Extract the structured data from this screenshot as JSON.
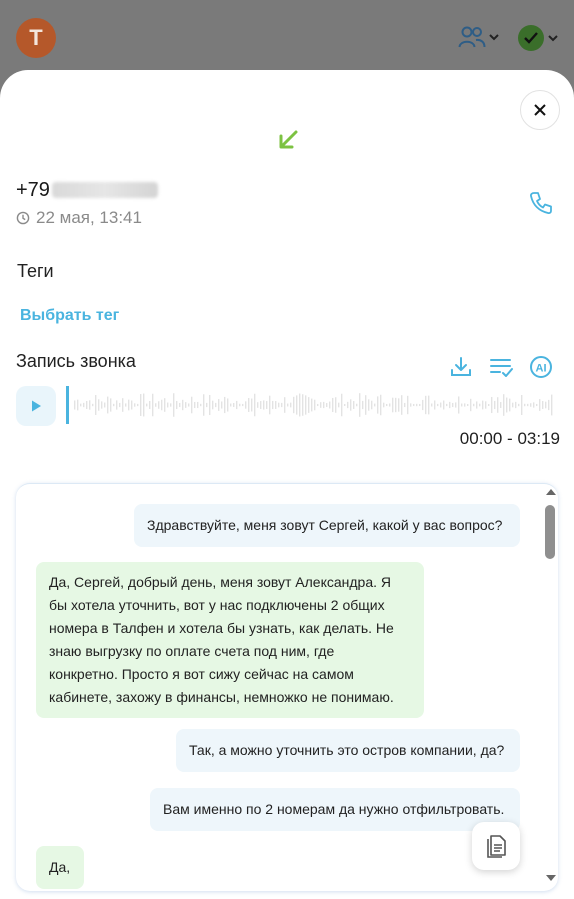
{
  "header": {
    "avatar_letter": "T",
    "users_icon": "users-icon",
    "status_icon": "check-circle-icon",
    "colors": {
      "avatar": "#b5582a",
      "status": "#3a6e2a",
      "accent": "#4ab4df",
      "incoming_arrow": "#7cc242"
    }
  },
  "call": {
    "direction_icon": "incoming-arrow-icon",
    "phone_prefix": "+79",
    "date": "22 мая, 13:41",
    "call_icon": "phone-icon"
  },
  "tags": {
    "title": "Теги",
    "choose_label": "Выбрать тег"
  },
  "recording": {
    "title": "Запись звонка",
    "tools": [
      "download-icon",
      "transcript-icon",
      "ai-icon"
    ],
    "time_range": "00:00 - 03:19",
    "progress": 0
  },
  "transcript": {
    "messages": [
      {
        "side": "out",
        "text": "Здравствуйте, меня зовут Сергей, какой у вас вопрос?"
      },
      {
        "side": "in",
        "lines": [
          "Да, Сергей, добрый день, меня зовут Александра. Я",
          "бы хотела уточнить, вот у нас подключены 2 общих",
          "номера в Талфен и хотела бы узнать, как делать. Не",
          "знаю выгрузку по оплате счета под ним, где",
          "конкретно. Просто я вот сижу сейчас на самом",
          "кабинете, захожу в финансы, немножко не понимаю."
        ]
      },
      {
        "side": "out",
        "text": "Так, а можно уточнить это остров компании, да?"
      },
      {
        "side": "out",
        "text": "Вам именно по 2 номерам да нужно отфильтровать."
      },
      {
        "side": "in",
        "text": "Да,"
      }
    ]
  }
}
